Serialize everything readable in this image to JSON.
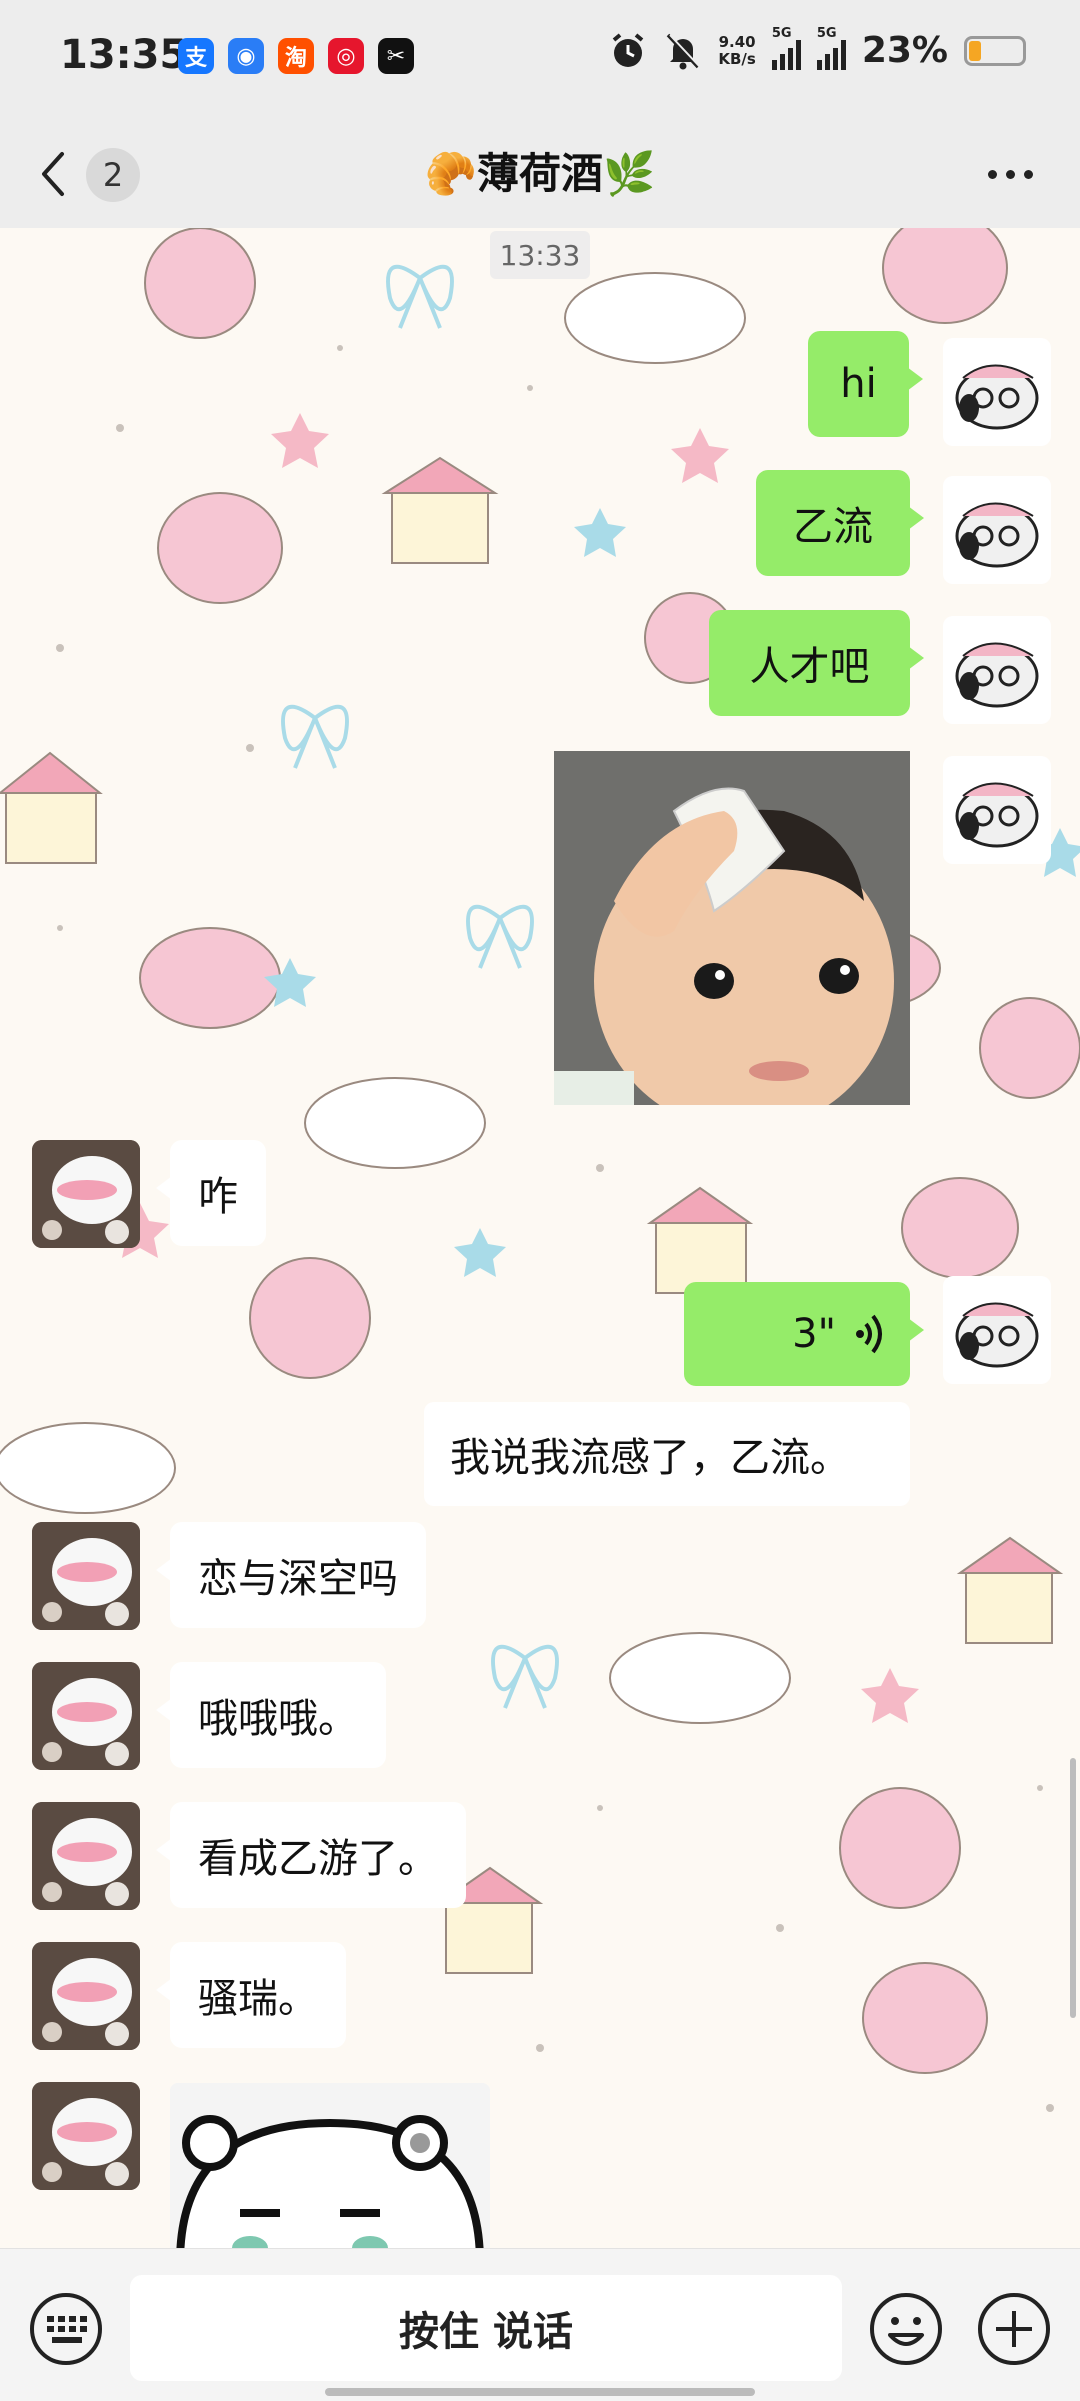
{
  "status_bar": {
    "time": "13:35",
    "apps": [
      {
        "name": "alipay-app-icon",
        "glyph": "支",
        "color": "#1677ff"
      },
      {
        "name": "chat-app-icon",
        "glyph": "◉",
        "color": "#2a7df6"
      },
      {
        "name": "taobao-app-icon",
        "glyph": "淘",
        "color": "#ff5000"
      },
      {
        "name": "weibo-app-icon",
        "glyph": "◎",
        "color": "#e6162d"
      },
      {
        "name": "capcut-app-icon",
        "glyph": "✂",
        "color": "#111111"
      }
    ],
    "speed_value": "9.40",
    "speed_unit": "KB/s",
    "network_1": "5G",
    "network_2": "5G",
    "battery_percent": "23%",
    "battery_level": 0.23
  },
  "header": {
    "unread_count": "2",
    "title": "🥐薄荷酒🌿"
  },
  "chat": {
    "timestamp": "13:33",
    "messages": [
      {
        "text": "hi"
      },
      {
        "text": "乙流"
      },
      {
        "text": "人才吧"
      },
      {
        "text": "咋"
      },
      {
        "text": "3\""
      },
      {
        "text": "我说我流感了，乙流。"
      },
      {
        "text": "恋与深空吗"
      },
      {
        "text": "哦哦哦。"
      },
      {
        "text": "看成乙游了。"
      },
      {
        "text": "骚瑞。"
      }
    ]
  },
  "input_bar": {
    "hold_to_talk": "按住 说话"
  },
  "colors": {
    "my_bubble": "#95ec69",
    "their_bubble": "#ffffff",
    "bar_background": "#ededed"
  }
}
